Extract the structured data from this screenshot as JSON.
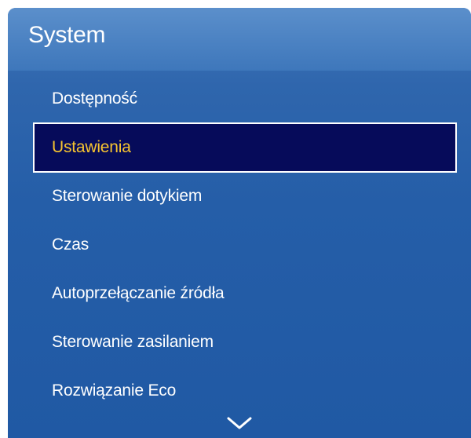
{
  "menu": {
    "title": "System",
    "items": [
      {
        "label": "Dostępność",
        "selected": false
      },
      {
        "label": "Ustawienia",
        "selected": true
      },
      {
        "label": "Sterowanie dotykiem",
        "selected": false
      },
      {
        "label": "Czas",
        "selected": false
      },
      {
        "label": "Autoprzełączanie źródła",
        "selected": false
      },
      {
        "label": "Sterowanie zasilaniem",
        "selected": false
      },
      {
        "label": "Rozwiązanie Eco",
        "selected": false
      }
    ],
    "scroll_indicator_icon": "chevron-down-icon"
  },
  "colors": {
    "panel": "#2059a4",
    "header": "#3e77bb",
    "selected_background": "#060b5a",
    "selected_text": "#f7c42f",
    "text": "#ffffff"
  }
}
